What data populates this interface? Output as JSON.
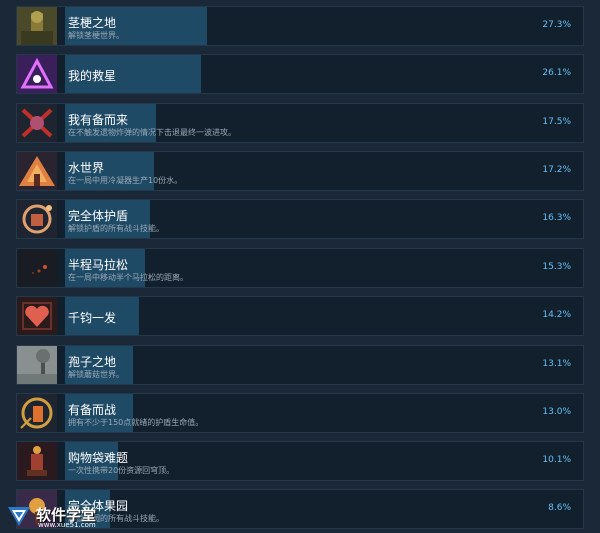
{
  "achievements": [
    {
      "title": "茎梗之地",
      "desc": "解锁茎梗世界。",
      "pct": "27.3%",
      "progress": 0.273,
      "icon": "forest-icon"
    },
    {
      "title": "我的救星",
      "desc": "",
      "pct": "26.1%",
      "progress": 0.261,
      "icon": "purple-triangle-icon"
    },
    {
      "title": "我有备而来",
      "desc": "在不触发遗物炸弹的情况下击退最终一波进攻。",
      "pct": "17.5%",
      "progress": 0.175,
      "icon": "crossed-bomb-icon"
    },
    {
      "title": "水世界",
      "desc": "在一局中用冷凝器生产10份水。",
      "pct": "17.2%",
      "progress": 0.172,
      "icon": "pyramid-icon"
    },
    {
      "title": "完全体护盾",
      "desc": "解锁护盾的所有战斗技能。",
      "pct": "16.3%",
      "progress": 0.163,
      "icon": "shield-icon"
    },
    {
      "title": "半程马拉松",
      "desc": "在一局中移动半个马拉松的距离。",
      "pct": "15.3%",
      "progress": 0.153,
      "icon": "dark-trail-icon"
    },
    {
      "title": "千钧一发",
      "desc": "",
      "pct": "14.2%",
      "progress": 0.142,
      "icon": "heart-icon"
    },
    {
      "title": "孢子之地",
      "desc": "解锁蘑菇世界。",
      "pct": "13.1%",
      "progress": 0.131,
      "icon": "fog-tree-icon"
    },
    {
      "title": "有备而战",
      "desc": "拥有不少于150点就绪的护盾生命值。",
      "pct": "13.0%",
      "progress": 0.13,
      "icon": "battle-shield-icon"
    },
    {
      "title": "购物袋难题",
      "desc": "一次性携带20份资源回穹顶。",
      "pct": "10.1%",
      "progress": 0.101,
      "icon": "robot-bag-icon"
    },
    {
      "title": "完全体果园",
      "desc": "解锁果园的所有战斗技能。",
      "pct": "8.6%",
      "progress": 0.086,
      "icon": "orchard-icon"
    }
  ],
  "watermark": {
    "name": "软件学堂",
    "url": "www.xue51.com"
  }
}
